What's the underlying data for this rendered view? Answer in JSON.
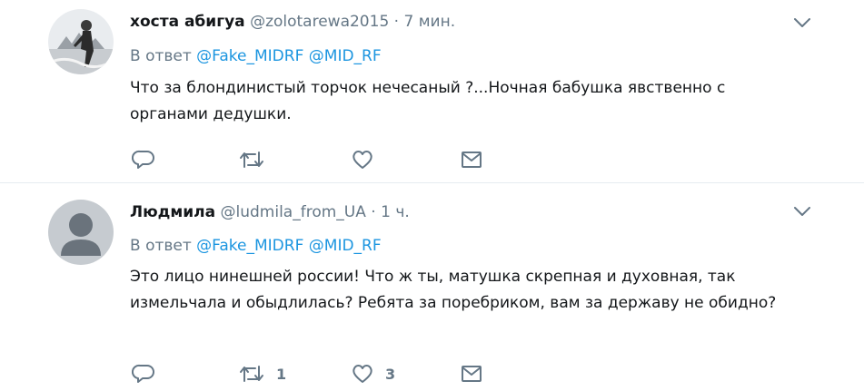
{
  "tweets": [
    {
      "name": "хоста абигуа",
      "handle": "@zolotarewa2015",
      "dot": "·",
      "time": "7 мин.",
      "reply_prefix": "В ответ",
      "reply_to": [
        "@Fake_MIDRF",
        "@MID_RF"
      ],
      "text": "Что за блондинистый торчок нечесаный ?...Ночная бабушка явственно с органами дедушки.",
      "retweets": "",
      "likes": ""
    },
    {
      "name": "Людмила",
      "handle": "@ludmila_from_UA",
      "dot": "·",
      "time": "1 ч.",
      "reply_prefix": "В ответ",
      "reply_to": [
        "@Fake_MIDRF",
        "@MID_RF"
      ],
      "text": "Это лицо нинешней россии! Что ж ты, матушка скрепная и духовная, так измельчала и обыдлилась? Ребята за поребриком, вам за державу не обидно?",
      "retweets": "1",
      "likes": "3"
    }
  ],
  "colors": {
    "text": "#14171a",
    "muted": "#657786",
    "link": "#1b95e0",
    "border": "#e6ecf0"
  },
  "icons": [
    "reply-icon",
    "retweet-icon",
    "like-icon",
    "direct-message-icon",
    "chevron-down-icon"
  ]
}
